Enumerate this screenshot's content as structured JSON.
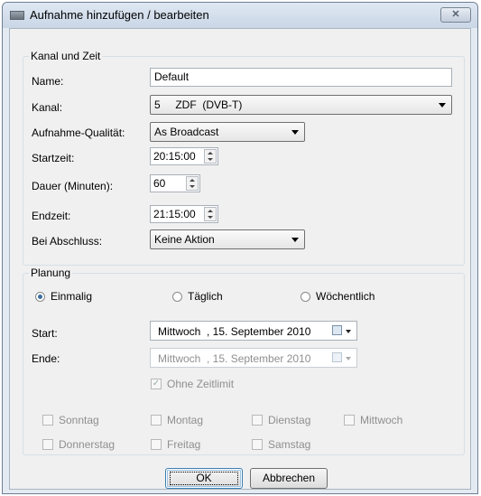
{
  "window": {
    "title": "Aufnahme hinzufügen / bearbeiten",
    "close_glyph": "✕"
  },
  "kanal_zeit": {
    "group_title": "Kanal und Zeit",
    "name_label": "Name:",
    "name_value": "Default",
    "kanal_label": "Kanal:",
    "kanal_value": "5     ZDF  (DVB-T)",
    "qualitaet_label": "Aufnahme-Qualität:",
    "qualitaet_value": "As Broadcast",
    "startzeit_label": "Startzeit:",
    "startzeit_value": "20:15:00",
    "dauer_label": "Dauer (Minuten):",
    "dauer_value": "60",
    "endzeit_label": "Endzeit:",
    "endzeit_value": "21:15:00",
    "abschluss_label": "Bei Abschluss:",
    "abschluss_value": "Keine Aktion"
  },
  "planung": {
    "group_title": "Planung",
    "radio_einmalig": "Einmalig",
    "radio_taeglich": "Täglich",
    "radio_woechentlich": "Wöchentlich",
    "selected": "Einmalig",
    "start_label": "Start:",
    "start_value": "Mittwoch  , 15. September 2010",
    "ende_label": "Ende:",
    "ende_value": "Mittwoch  , 15. September 2010",
    "ohne_zeitlimit": "Ohne Zeitlimit",
    "days": {
      "sonntag": "Sonntag",
      "montag": "Montag",
      "dienstag": "Dienstag",
      "mittwoch": "Mittwoch",
      "donnerstag": "Donnerstag",
      "freitag": "Freitag",
      "samstag": "Samstag"
    }
  },
  "buttons": {
    "ok": "OK",
    "abbrechen": "Abbrechen"
  },
  "icons": {
    "window": "recording-app-icon",
    "close": "close-icon",
    "calendar": "calendar-icon"
  }
}
